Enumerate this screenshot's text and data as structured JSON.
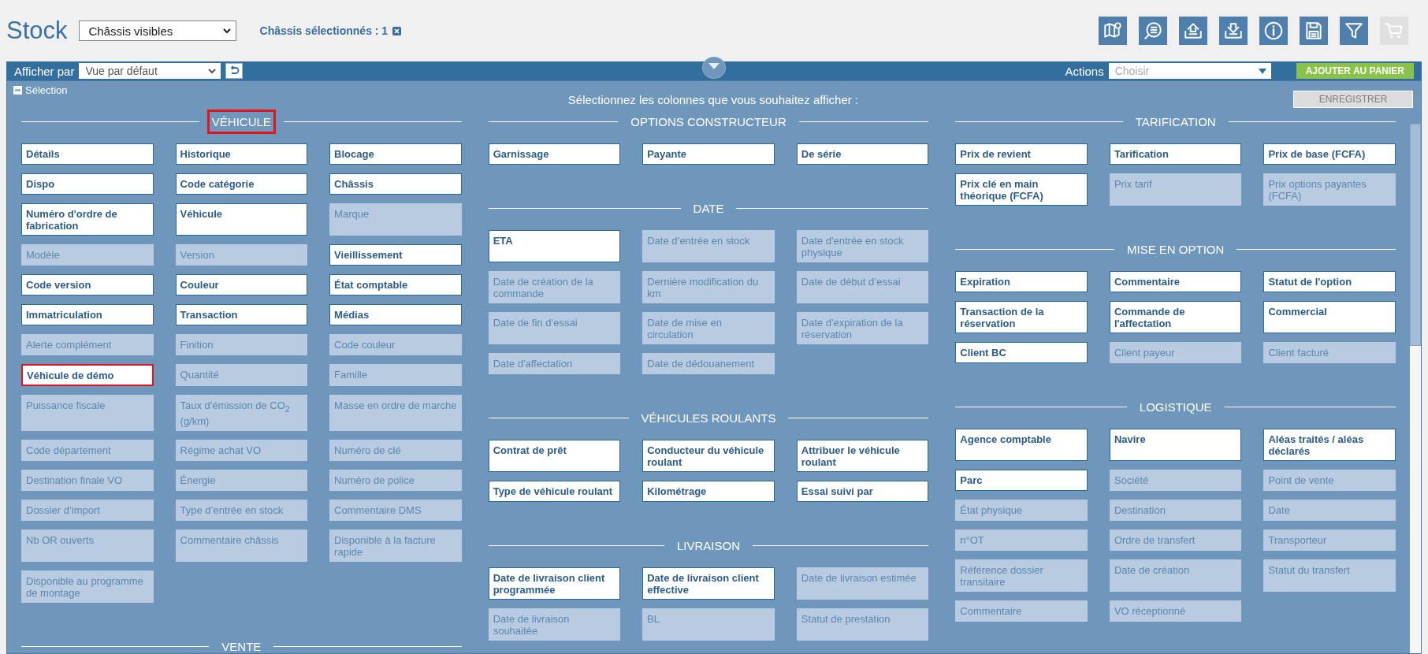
{
  "header": {
    "title": "Stock",
    "view_select": {
      "value": "Châssis visibles"
    },
    "selection_count": "Châssis sélectionnés : 1",
    "icons": [
      {
        "kind": "map",
        "disabled": false
      },
      {
        "kind": "list-search",
        "disabled": false
      },
      {
        "kind": "upload",
        "disabled": false
      },
      {
        "kind": "download",
        "disabled": false
      },
      {
        "kind": "info",
        "disabled": false
      },
      {
        "kind": "save",
        "disabled": false
      },
      {
        "kind": "filter",
        "disabled": false
      },
      {
        "kind": "cart",
        "disabled": true
      }
    ]
  },
  "toolbar": {
    "display_label": "Afficher par",
    "view_select": {
      "value": "Vue par défaut"
    },
    "actions_label": "Actions",
    "actions_select": {
      "placeholder": "Choisir"
    },
    "add_button": "AJOUTER AU PANIER"
  },
  "panel": {
    "toggle_label": "Sélection",
    "instruction": "Sélectionnez les colonnes que vous souhaitez afficher :",
    "save_button": {
      "label": "ENREGISTRER",
      "disabled": true
    },
    "columns": [
      {
        "sections": [
          {
            "title": "VÉHICULE",
            "highlighted": true,
            "items": [
              {
                "label": "Détails",
                "selected": true,
                "highlighted": false
              },
              {
                "label": "Historique",
                "selected": true,
                "highlighted": false
              },
              {
                "label": "Blocage",
                "selected": true,
                "highlighted": false
              },
              {
                "label": "Dispo",
                "selected": true,
                "highlighted": false
              },
              {
                "label": "Code catégorie",
                "selected": true,
                "highlighted": false
              },
              {
                "label": "Châssis",
                "selected": true,
                "highlighted": false
              },
              {
                "label": "Numéro d'ordre de fabrication",
                "selected": true,
                "highlighted": false
              },
              {
                "label": "Véhicule",
                "selected": true,
                "highlighted": false
              },
              {
                "label": "Marque",
                "selected": false,
                "highlighted": false
              },
              {
                "label": "Modèle",
                "selected": false,
                "highlighted": false
              },
              {
                "label": "Version",
                "selected": false,
                "highlighted": false
              },
              {
                "label": "Vieillissement",
                "selected": true,
                "highlighted": false
              },
              {
                "label": "Code version",
                "selected": true,
                "highlighted": false
              },
              {
                "label": "Couleur",
                "selected": true,
                "highlighted": false
              },
              {
                "label": "État comptable",
                "selected": true,
                "highlighted": false
              },
              {
                "label": "Immatriculation",
                "selected": true,
                "highlighted": false
              },
              {
                "label": "Transaction",
                "selected": true,
                "highlighted": false
              },
              {
                "label": "Médias",
                "selected": true,
                "highlighted": false
              },
              {
                "label": "Alerte complément",
                "selected": false,
                "highlighted": false
              },
              {
                "label": "Finition",
                "selected": false,
                "highlighted": false
              },
              {
                "label": "Code couleur",
                "selected": false,
                "highlighted": false
              },
              {
                "label": "Véhicule de démo",
                "selected": true,
                "highlighted": true
              },
              {
                "label": "Quantité",
                "selected": false,
                "highlighted": false
              },
              {
                "label": "Famille",
                "selected": false,
                "highlighted": false
              },
              {
                "label": "Puissance fiscale",
                "selected": false,
                "highlighted": false
              },
              {
                "label": "Taux d'émission de CO$_{2}$ (g/km)",
                "selected": false,
                "highlighted": false
              },
              {
                "label": "Masse en ordre de marche",
                "selected": false,
                "highlighted": false
              },
              {
                "label": "Code département",
                "selected": false,
                "highlighted": false
              },
              {
                "label": "Régime achat VO",
                "selected": false,
                "highlighted": false
              },
              {
                "label": "Numéro de clé",
                "selected": false,
                "highlighted": false
              },
              {
                "label": "Destination finale VO",
                "selected": false,
                "highlighted": false
              },
              {
                "label": "Énergie",
                "selected": false,
                "highlighted": false
              },
              {
                "label": "Numéro de police",
                "selected": false,
                "highlighted": false
              },
              {
                "label": "Dossier d’import",
                "selected": false,
                "highlighted": false
              },
              {
                "label": "Type d’entrée en stock",
                "selected": false,
                "highlighted": false
              },
              {
                "label": "Commentaire DMS",
                "selected": false,
                "highlighted": false
              },
              {
                "label": "Nb OR ouverts",
                "selected": false,
                "highlighted": false
              },
              {
                "label": "Commentaire châssis",
                "selected": false,
                "highlighted": false
              },
              {
                "label": "Disponible à la facture rapide",
                "selected": false,
                "highlighted": false
              },
              {
                "label": "Disponible au programme de montage",
                "selected": false,
                "highlighted": false
              }
            ]
          },
          {
            "title": "VENTE",
            "highlighted": false
          }
        ]
      },
      {
        "sections": [
          {
            "title": "OPTIONS CONSTRUCTEUR",
            "highlighted": false,
            "items": [
              {
                "label": "Garnissage",
                "selected": true,
                "highlighted": false
              },
              {
                "label": "Payante",
                "selected": true,
                "highlighted": false
              },
              {
                "label": "De série",
                "selected": true,
                "highlighted": false
              }
            ]
          },
          {
            "title": "DATE",
            "highlighted": false,
            "items": [
              {
                "label": "ETA",
                "selected": true,
                "highlighted": false
              },
              {
                "label": "Date d’entrée en stock",
                "selected": false,
                "highlighted": false
              },
              {
                "label": "Date d'entrée en stock physique",
                "selected": false,
                "highlighted": false
              },
              {
                "label": "Date de création de la commande",
                "selected": false,
                "highlighted": false
              },
              {
                "label": "Dernière modification du km",
                "selected": false,
                "highlighted": false
              },
              {
                "label": "Date de début d’essai",
                "selected": false,
                "highlighted": false
              },
              {
                "label": "Date de fin d’essai",
                "selected": false,
                "highlighted": false
              },
              {
                "label": "Date de mise en circulation",
                "selected": false,
                "highlighted": false
              },
              {
                "label": "Date d'expiration de la réservation",
                "selected": false,
                "highlighted": false
              },
              {
                "label": "Date d'affectation",
                "selected": false,
                "highlighted": false
              },
              {
                "label": "Date de dédouanement",
                "selected": false,
                "highlighted": false
              }
            ]
          },
          {
            "title": "VÉHICULES ROULANTS",
            "highlighted": false,
            "items": [
              {
                "label": "Contrat de prêt",
                "selected": true,
                "highlighted": false
              },
              {
                "label": "Conducteur du véhicule roulant",
                "selected": true,
                "highlighted": false
              },
              {
                "label": "Attribuer le véhicule roulant",
                "selected": true,
                "highlighted": false
              },
              {
                "label": "Type de véhicule roulant",
                "selected": true,
                "highlighted": false
              },
              {
                "label": "Kilométrage",
                "selected": true,
                "highlighted": false
              },
              {
                "label": "Essai suivi par",
                "selected": true,
                "highlighted": false
              }
            ]
          },
          {
            "title": "LIVRAISON",
            "highlighted": false,
            "items": [
              {
                "label": "Date de livraison client programmée",
                "selected": true,
                "highlighted": false
              },
              {
                "label": "Date de livraison client effective",
                "selected": true,
                "highlighted": false
              },
              {
                "label": "Date de livraison estimée",
                "selected": false,
                "highlighted": false
              },
              {
                "label": "Date de livraison souhaitée",
                "selected": false,
                "highlighted": false
              },
              {
                "label": "BL",
                "selected": false,
                "highlighted": false
              },
              {
                "label": "Statut de prestation",
                "selected": false,
                "highlighted": false
              }
            ]
          }
        ]
      },
      {
        "sections": [
          {
            "title": "TARIFICATION",
            "highlighted": false,
            "items": [
              {
                "label": "Prix de revient",
                "selected": true,
                "highlighted": false
              },
              {
                "label": "Tarification",
                "selected": true,
                "highlighted": false
              },
              {
                "label": "Prix de base (FCFA)",
                "selected": true,
                "highlighted": false
              },
              {
                "label": "Prix clé en main théorique (FCFA)",
                "selected": true,
                "highlighted": false
              },
              {
                "label": "Prix tarif",
                "selected": false,
                "highlighted": false
              },
              {
                "label": "Prix options payantes (FCFA)",
                "selected": false,
                "highlighted": false
              }
            ]
          },
          {
            "title": "MISE EN OPTION",
            "highlighted": false,
            "items": [
              {
                "label": "Expiration",
                "selected": true,
                "highlighted": false
              },
              {
                "label": "Commentaire",
                "selected": true,
                "highlighted": false
              },
              {
                "label": "Statut de l'option",
                "selected": true,
                "highlighted": false
              },
              {
                "label": "Transaction de la réservation",
                "selected": true,
                "highlighted": false
              },
              {
                "label": "Commande de l'affectation",
                "selected": true,
                "highlighted": false
              },
              {
                "label": "Commercial",
                "selected": true,
                "highlighted": false
              },
              {
                "label": "Client BC",
                "selected": true,
                "highlighted": false
              },
              {
                "label": "Client payeur",
                "selected": false,
                "highlighted": false
              },
              {
                "label": "Client facturé",
                "selected": false,
                "highlighted": false
              }
            ]
          },
          {
            "title": "LOGISTIQUE",
            "highlighted": false,
            "items": [
              {
                "label": "Agence comptable",
                "selected": true,
                "highlighted": false
              },
              {
                "label": "Navire",
                "selected": true,
                "highlighted": false
              },
              {
                "label": "Aléas traités / aléas déclarés",
                "selected": true,
                "highlighted": false
              },
              {
                "label": "Parc",
                "selected": true,
                "highlighted": false
              },
              {
                "label": "Société",
                "selected": false,
                "highlighted": false
              },
              {
                "label": "Point de vente",
                "selected": false,
                "highlighted": false
              },
              {
                "label": "État physique",
                "selected": false,
                "highlighted": false
              },
              {
                "label": "Destination",
                "selected": false,
                "highlighted": false
              },
              {
                "label": "Date",
                "selected": false,
                "highlighted": false
              },
              {
                "label": "n°OT",
                "selected": false,
                "highlighted": false
              },
              {
                "label": "Ordre de transfert",
                "selected": false,
                "highlighted": false
              },
              {
                "label": "Transporteur",
                "selected": false,
                "highlighted": false
              },
              {
                "label": "Référence dossier transitaire",
                "selected": false,
                "highlighted": false
              },
              {
                "label": "Date de création",
                "selected": false,
                "highlighted": false
              },
              {
                "label": "Statut du transfert",
                "selected": false,
                "highlighted": false
              },
              {
                "label": "Commentaire",
                "selected": false,
                "highlighted": false
              },
              {
                "label": "VO réceptionné",
                "selected": false,
                "highlighted": false
              }
            ]
          }
        ]
      }
    ]
  }
}
